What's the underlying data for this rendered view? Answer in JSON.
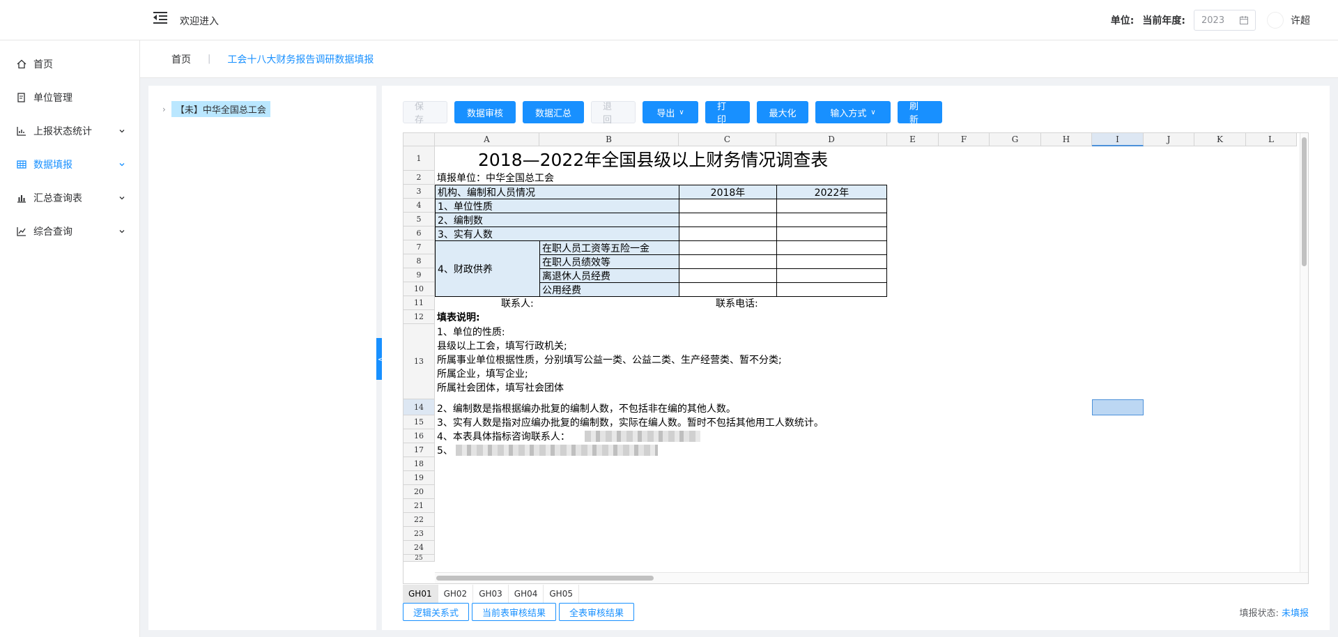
{
  "header": {
    "welcome": "欢迎进入",
    "unit_label": "单位:",
    "year_label": "当前年度:",
    "year_value": "2023",
    "username": "许超"
  },
  "sidebar": {
    "items": [
      {
        "label": "首页",
        "icon": "home-icon"
      },
      {
        "label": "单位管理",
        "icon": "document-icon"
      },
      {
        "label": "上报状态统计",
        "icon": "chart-icon"
      },
      {
        "label": "数据填报",
        "icon": "table-icon"
      },
      {
        "label": "汇总查询表",
        "icon": "bar-chart-icon"
      },
      {
        "label": "综合查询",
        "icon": "line-chart-icon"
      }
    ],
    "active_color": "#1890ff"
  },
  "breadcrumb": {
    "home": "首页",
    "current": "工会十八大财务报告调研数据填报"
  },
  "tree": {
    "root": "【未】中华全国总工会"
  },
  "toolbar": {
    "save": "保 存",
    "audit": "数据审核",
    "summary": "数据汇总",
    "back": "退 回",
    "export": "导出",
    "print": "打 印",
    "maximize": "最大化",
    "input_mode": "输入方式",
    "refresh": "刷 新"
  },
  "sheet": {
    "columns": [
      "A",
      "B",
      "C",
      "D",
      "E",
      "F",
      "G",
      "H",
      "I",
      "J",
      "K",
      "L"
    ],
    "rows": [
      "1",
      "2",
      "3",
      "4",
      "5",
      "6",
      "7",
      "8",
      "9",
      "10",
      "11",
      "12",
      "13",
      "14",
      "15",
      "16",
      "17",
      "18",
      "19",
      "20",
      "21",
      "22",
      "23",
      "24",
      "25"
    ],
    "title": "2018—2022年全国县级以上财务情况调查表",
    "unit_fill": "填报单位：中华全国总工会",
    "header_org": "机构、编制和人员情况",
    "header_2018": "2018年",
    "header_2022": "2022年",
    "r4": "1、单位性质",
    "r5": "2、编制数",
    "r6": "3、实有人数",
    "r7_10_merged": "4、财政供养",
    "r7": "在职人员工资等五险一金",
    "r8": "在职人员绩效等",
    "r9": "离退休人员经费",
    "r10": "公用经费",
    "contact": "联系人:",
    "phone": "联系电话:",
    "notes_title": "填表说明:",
    "note13_1": "1、单位的性质:",
    "note13_2": "县级以上工会，填写行政机关;",
    "note13_3": "所属事业单位根据性质，分别填写公益一类、公益二类、生产经营类、暂不分类;",
    "note13_4": "所属企业，填写企业;",
    "note13_5": "所属社会团体，填写社会团体",
    "note14": "2、编制数是指根据编办批复的编制人数，不包括非在编的其他人数。",
    "note15": "3、实有人数是指对应编办批复的编制数，实际在编人数。暂时不包括其他用工人数统计。",
    "note16": "4、本表具体指标咨询联系人：",
    "note17": "5、"
  },
  "sheet_tabs": [
    "GH01",
    "GH02",
    "GH03",
    "GH04",
    "GH05"
  ],
  "bottom": {
    "logic": "逻辑关系式",
    "current_audit": "当前表审核结果",
    "all_audit": "全表审核结果",
    "status_label": "填报状态:",
    "status_value": "未填报"
  }
}
